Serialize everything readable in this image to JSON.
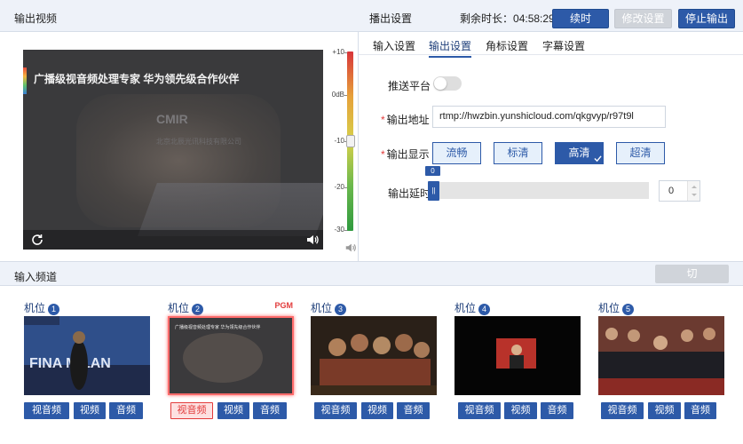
{
  "header": {
    "title": "输出视频",
    "settings_title": "播出设置",
    "remaining_label": "剩余时长：",
    "remaining_time": "04:58:29",
    "renew_label": "续时",
    "modify_label": "修改设置",
    "stop_label": "停止输出"
  },
  "preview": {
    "caption": "广播级视音频处理专家 华为领先级合作伙伴",
    "logo_text": "CMIR",
    "logo_sub": "北京北辰光讯科技有限公司",
    "icons": {
      "refresh": "refresh-icon",
      "volume": "speaker-icon"
    }
  },
  "meter": {
    "ticks": [
      "+10",
      "0dB",
      "-10",
      "-20",
      "-30"
    ],
    "colors": {
      "top": "#d8353a",
      "mid": "#d6d04a",
      "bottom": "#2f9a3f"
    }
  },
  "tabs": [
    {
      "label": "输入设置",
      "active": false
    },
    {
      "label": "输出设置",
      "active": true
    },
    {
      "label": "角标设置",
      "active": false
    },
    {
      "label": "字幕设置",
      "active": false
    }
  ],
  "output": {
    "platform_label": "推送平台",
    "platform_enabled": false,
    "address_label": "输出地址",
    "address_value": "rtmp://hwzbin.yunshicloud.com/qkgvyp/r97t9l",
    "display_label": "输出显示",
    "quality_options": [
      "流畅",
      "标清",
      "高清",
      "超清"
    ],
    "quality_selected": "高清",
    "delay_label": "输出延时",
    "delay_slider_value": "0",
    "delay_input_value": "0"
  },
  "input_bar": {
    "title": "输入频道",
    "switch_label": "切换"
  },
  "cameras": [
    {
      "label": "机位",
      "num": "1",
      "pgm": "",
      "buttons": [
        "视音频",
        "视频",
        "音频"
      ],
      "active_button": ""
    },
    {
      "label": "机位",
      "num": "2",
      "pgm": "PGM",
      "buttons": [
        "视音频",
        "视频",
        "音频"
      ],
      "active_button": "视音频",
      "caption": "广播级视音频处理专家 华为领先级合作伙伴"
    },
    {
      "label": "机位",
      "num": "3",
      "pgm": "",
      "buttons": [
        "视音频",
        "视频",
        "音频"
      ],
      "active_button": ""
    },
    {
      "label": "机位",
      "num": "4",
      "pgm": "",
      "buttons": [
        "视音频",
        "视频",
        "音频"
      ],
      "active_button": ""
    },
    {
      "label": "机位",
      "num": "5",
      "pgm": "",
      "buttons": [
        "视音频",
        "视频",
        "音频"
      ],
      "active_button": ""
    }
  ],
  "colors": {
    "accent": "#2d5aa8",
    "danger": "#e23b3b",
    "header_bg": "#eef2f9"
  }
}
